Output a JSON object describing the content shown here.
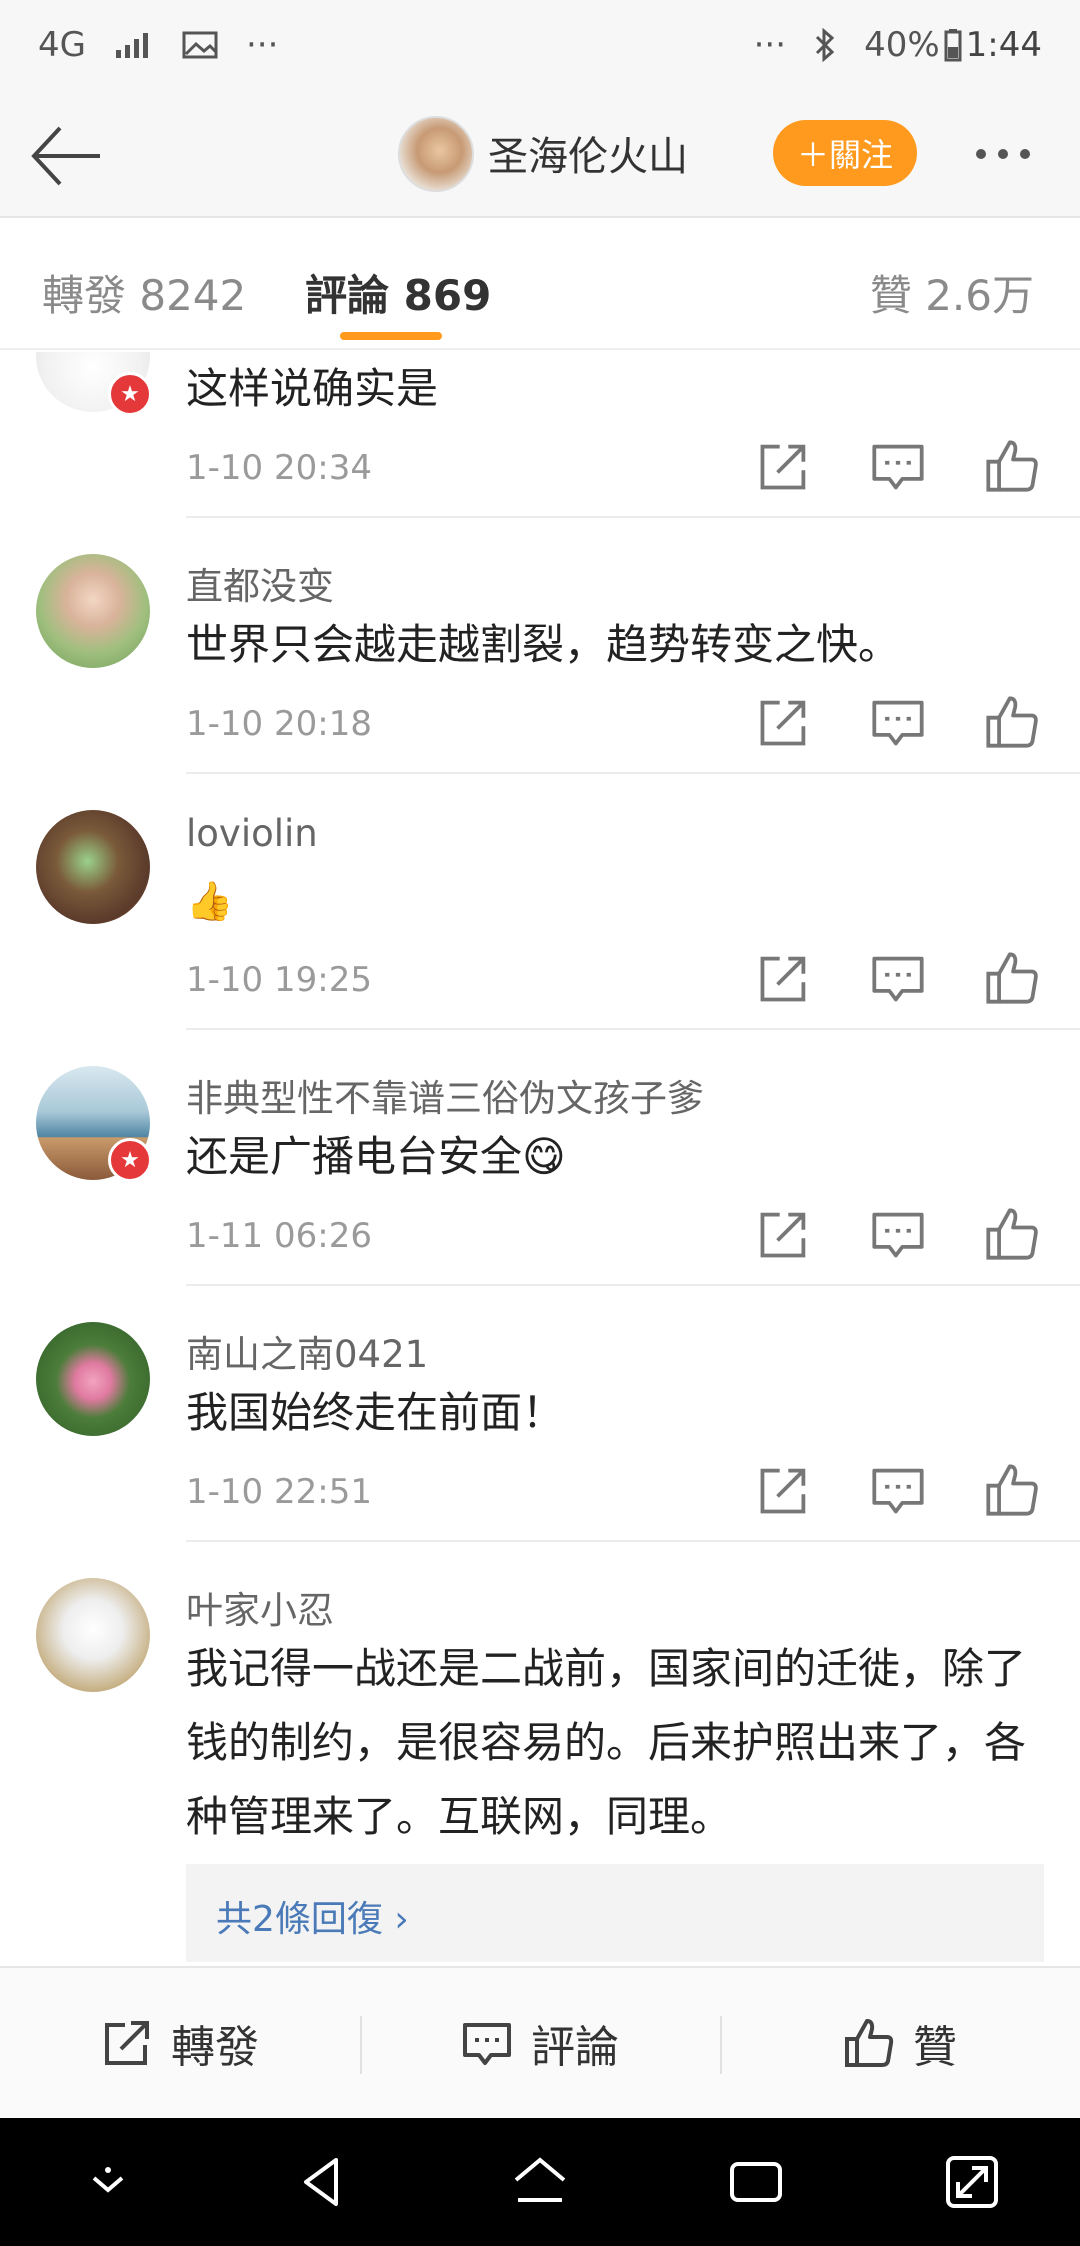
{
  "status_bar": {
    "network": "4G",
    "more": "···",
    "right_more": "···",
    "battery": "40%",
    "time": "1:44"
  },
  "header": {
    "title": "圣海伦火山",
    "follow_label": "＋關注"
  },
  "tabs": {
    "repost": "轉發 8242",
    "comment": "評論 869",
    "like": "贊 2.6万"
  },
  "comments": [
    {
      "name": "",
      "text": "这样说确实是",
      "time": "1-10 20:34"
    },
    {
      "name": "直都没变",
      "text": "世界只会越走越割裂，趋势转变之快。",
      "time": "1-10 20:18"
    },
    {
      "name": "loviolin",
      "text": "👍",
      "time": "1-10 19:25"
    },
    {
      "name": "非典型性不靠谱三俗伪文孩子爹",
      "text": "还是广播电台安全😋",
      "time": "1-11 06:26"
    },
    {
      "name": "南山之南0421",
      "text": "我国始终走在前面！",
      "time": "1-10 22:51"
    },
    {
      "name": "叶家小忍",
      "text": "我记得一战还是二战前，国家间的迁徙，除了钱的制约，是很容易的。后来护照出来了，各种管理来了。互联网，同理。",
      "time": ""
    }
  ],
  "reply_link": "共2條回復 ›",
  "bottom_bar": {
    "repost": "轉發",
    "comment": "評論",
    "like": "贊"
  },
  "colors": {
    "accent": "#ff9a1e",
    "link": "#4a7ab8",
    "verified_badge": "#e5383b"
  }
}
